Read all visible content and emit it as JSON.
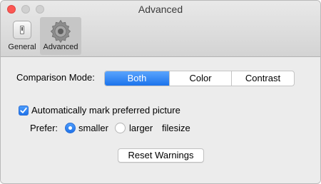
{
  "window": {
    "title": "Advanced"
  },
  "toolbar": {
    "tabs": [
      {
        "label": "General",
        "icon": "general-switch-icon",
        "selected": false
      },
      {
        "label": "Advanced",
        "icon": "gear-icon",
        "selected": true
      }
    ]
  },
  "comparison": {
    "label": "Comparison Mode:",
    "options": [
      "Both",
      "Color",
      "Contrast"
    ],
    "selected": "Both"
  },
  "auto_mark": {
    "label": "Automatically mark preferred picture",
    "checked": true
  },
  "prefer": {
    "label": "Prefer:",
    "options": [
      "smaller",
      "larger"
    ],
    "selected": "smaller",
    "suffix": "filesize"
  },
  "reset_button": {
    "label": "Reset Warnings"
  },
  "colors": {
    "accent": "#1b73ec",
    "close_button": "#fc5753"
  }
}
